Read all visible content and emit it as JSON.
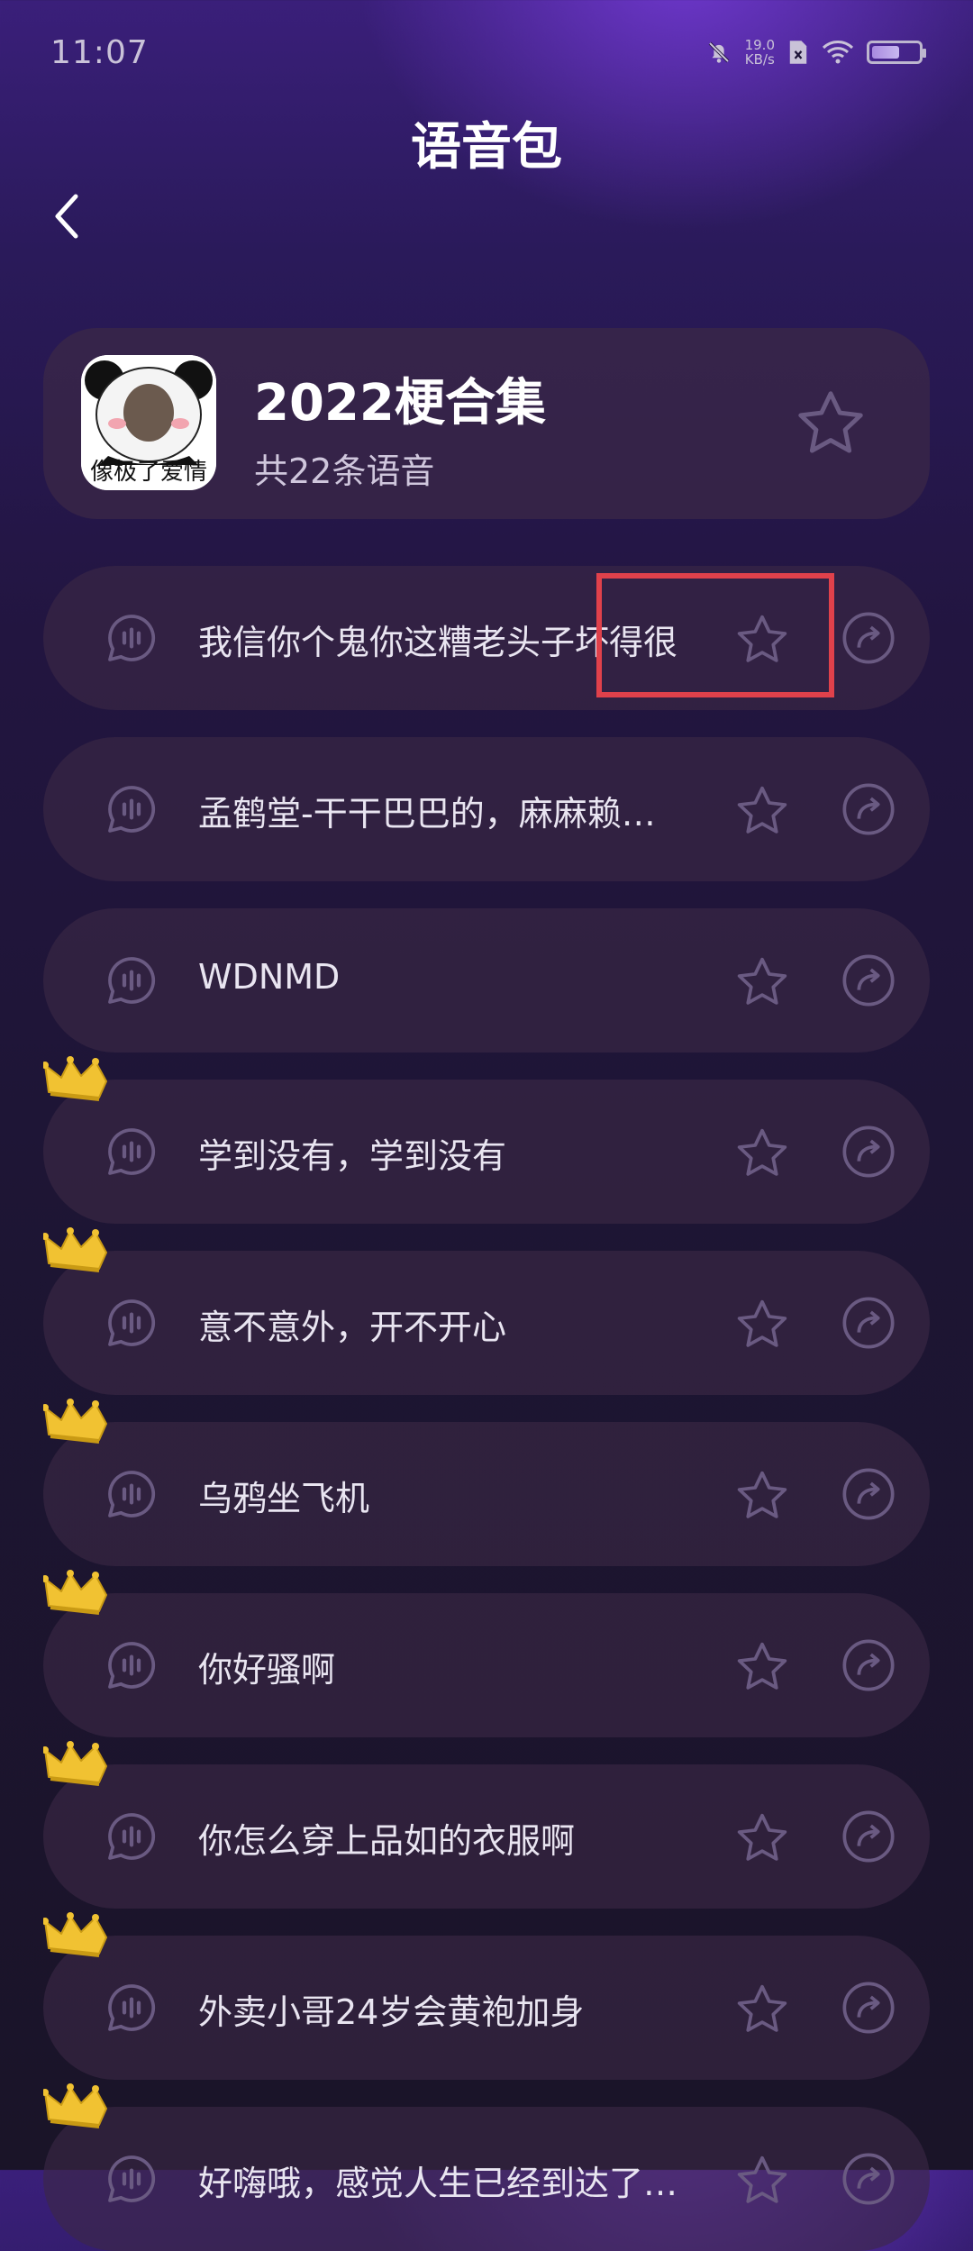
{
  "status_bar": {
    "time": "11:07",
    "speed_value": "19.0",
    "speed_unit": "KB/s"
  },
  "page": {
    "title": "语音包"
  },
  "pack": {
    "name": "2022梗合集",
    "count": "共22条语音",
    "avatar_caption": "像极了爱情"
  },
  "items": [
    {
      "label": "我信你个鬼你这糟老头子坏得很",
      "crown": false
    },
    {
      "label": "孟鹤堂-干干巴巴的，麻麻赖…",
      "crown": false
    },
    {
      "label": "WDNMD",
      "crown": false
    },
    {
      "label": "学到没有，学到没有",
      "crown": true
    },
    {
      "label": "意不意外，开不开心",
      "crown": true
    },
    {
      "label": "乌鸦坐飞机",
      "crown": true
    },
    {
      "label": "你好骚啊",
      "crown": true
    },
    {
      "label": "你怎么穿上品如的衣服啊",
      "crown": true
    },
    {
      "label": "外卖小哥24岁会黄袍加身",
      "crown": true
    },
    {
      "label": "好嗨哦，感觉人生已经到达了…",
      "crown": true
    }
  ],
  "colors": {
    "accent_highlight": "#e0414b",
    "icon": "#6a5a82"
  },
  "icons": [
    "back-arrow-icon",
    "star-icon",
    "voice-bubble-icon",
    "share-icon",
    "crown-icon",
    "mute-bell-icon",
    "wifi-icon",
    "battery-icon"
  ]
}
